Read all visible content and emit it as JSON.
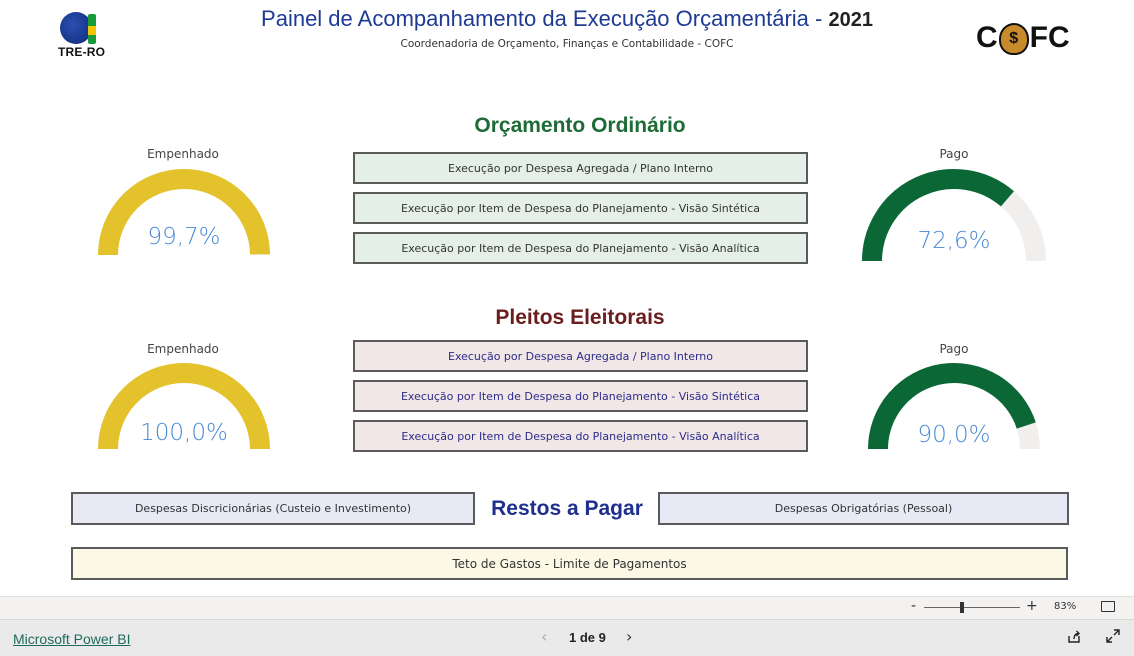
{
  "header": {
    "logo_left_text": "TRE-RO",
    "title": "Painel de Acompanhamento da Execução Orçamentária - ",
    "title_year": "2021",
    "subtitle": "Coordenadoria de Orçamento, Finanças e Contabilidade - COFC",
    "logo_right_left": "C",
    "logo_right_bag": "$",
    "logo_right_right": "FC"
  },
  "ordinario": {
    "title": "Orçamento Ordinário",
    "empenhado": {
      "label": "Empenhado",
      "value_text": "99,7%",
      "fraction": 0.997,
      "color": "#e3c22b"
    },
    "pago": {
      "label": "Pago",
      "value_text": "72,6%",
      "fraction": 0.726,
      "color": "#0b6836"
    },
    "buttons": [
      "Execução por Despesa Agregada / Plano Interno",
      "Execução por Item de Despesa do Planejamento - Visão Sintética",
      "Execução por Item de Despesa do Planejamento - Visão Analítica"
    ]
  },
  "pleitos": {
    "title": "Pleitos Eleitorais",
    "empenhado": {
      "label": "Empenhado",
      "value_text": "100,0%",
      "fraction": 1.0,
      "color": "#e3c22b"
    },
    "pago": {
      "label": "Pago",
      "value_text": "90,0%",
      "fraction": 0.9,
      "color": "#0b6836"
    },
    "buttons": [
      "Execução por Despesa Agregada / Plano Interno",
      "Execução por Item de Despesa do Planejamento - Visão Sintética",
      "Execução por Item de Despesa do Planejamento - Visão Analítica"
    ]
  },
  "restos": {
    "title": "Restos a Pagar",
    "left_button": "Despesas Discricionárias (Custeio e Investimento)",
    "right_button": "Despesas Obrigatórias (Pessoal)"
  },
  "teto_button": "Teto de Gastos - Limite de Pagamentos",
  "footer": {
    "zoom_minus": "-",
    "zoom_plus": "+",
    "zoom_value": "83%",
    "zoom_level": 0.83,
    "powerbi_link": "Microsoft Power BI",
    "prev_glyph": "‹",
    "next_glyph": "›",
    "page_indicator": "1 de 9"
  },
  "colors": {
    "gauge_track": "#f0efee",
    "value_text": "#4a8ad4"
  }
}
